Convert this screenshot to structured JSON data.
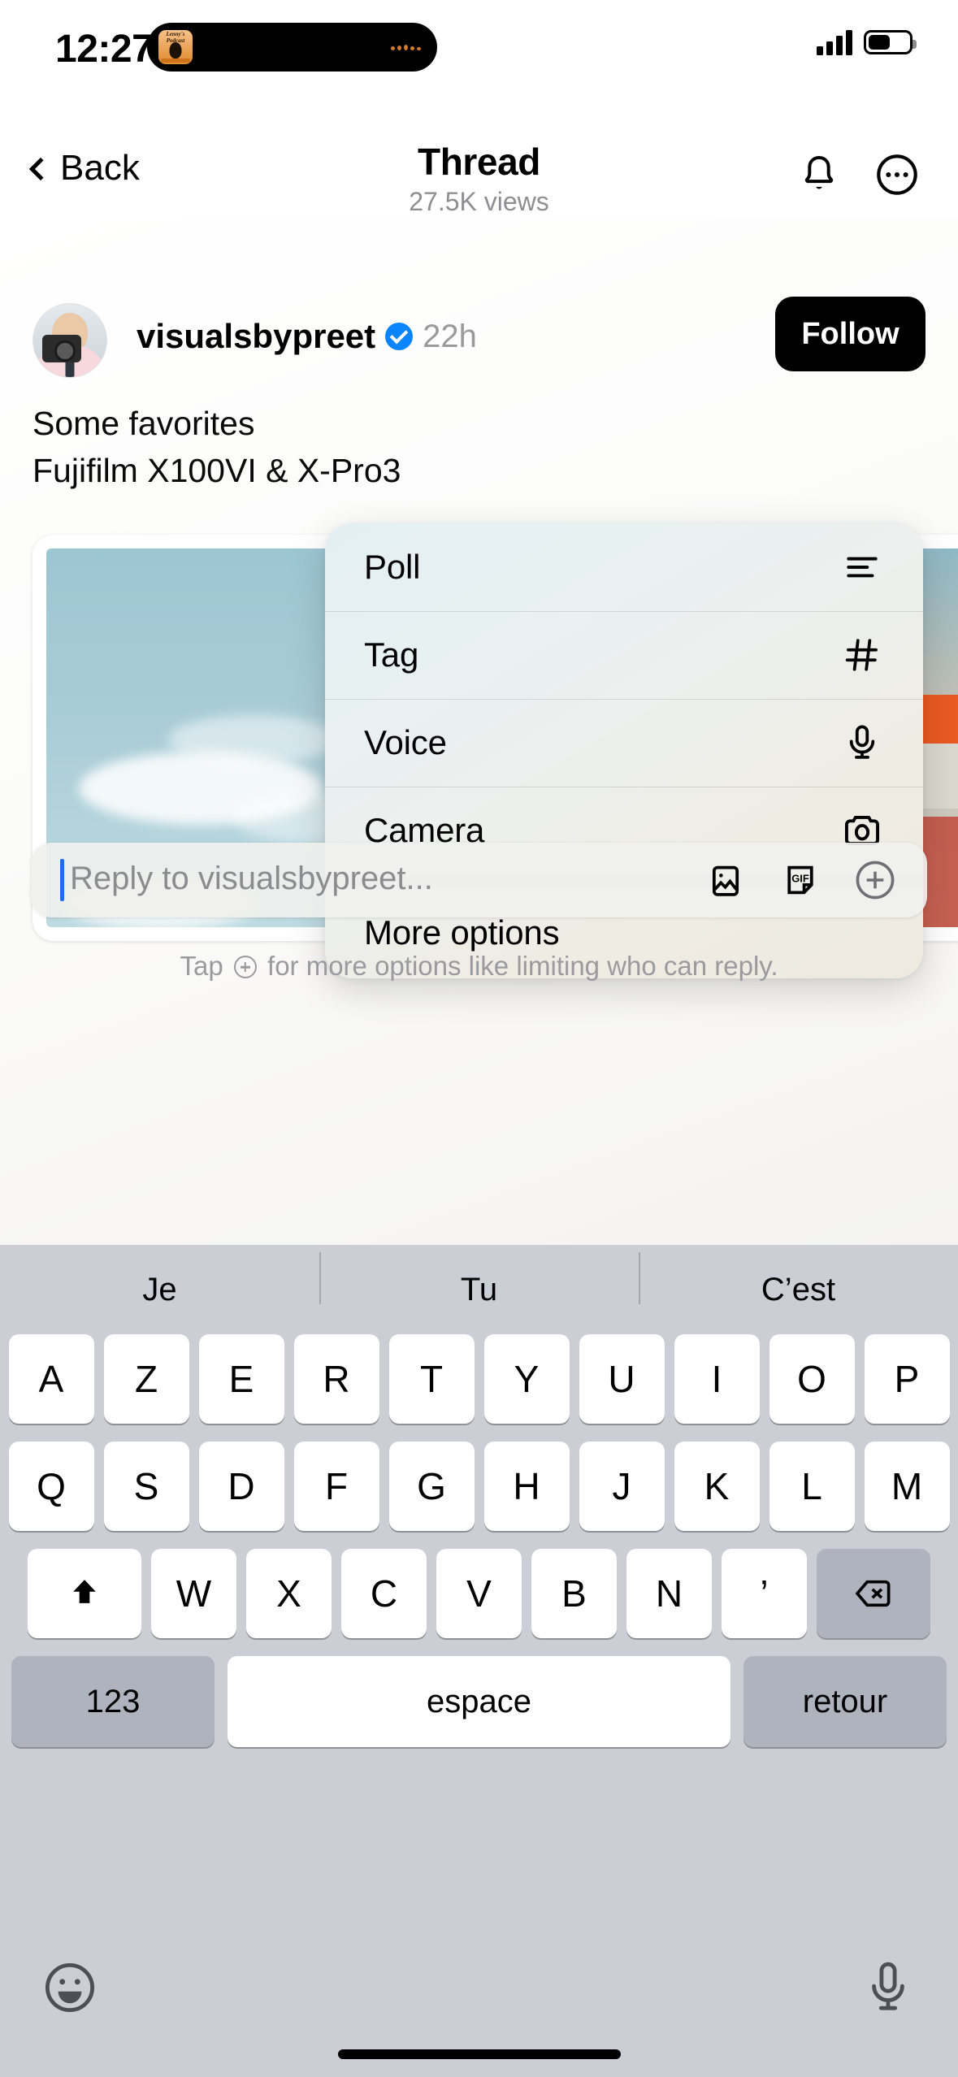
{
  "status_bar": {
    "time": "12:27",
    "dynamic_island": {
      "app": "Lenny's Podcast",
      "art_line1": "Lenny's",
      "art_line2": "Podcast"
    },
    "signal_icon": "cellular-signal-icon",
    "battery_icon": "battery-icon"
  },
  "navbar": {
    "back_label": "Back",
    "title": "Thread",
    "subtitle": "27.5K views",
    "bell_icon": "bell-icon",
    "more_icon": "more-circle-icon"
  },
  "post": {
    "username": "visualsbypreet",
    "verified": true,
    "timeago": "22h",
    "follow_label": "Follow",
    "text_line1": "Some favorites",
    "text_line2": "Fujifilm X100VI & X-Pro3",
    "media": [
      {
        "alt": "Shell gas station sign against blue sky with clouds"
      },
      {
        "alt": "Gas station canopy with orange trim"
      }
    ]
  },
  "context_menu": {
    "items": [
      {
        "label": "Poll",
        "icon": "poll-icon"
      },
      {
        "label": "Tag",
        "icon": "hashtag-icon"
      },
      {
        "label": "Voice",
        "icon": "microphone-icon"
      },
      {
        "label": "Camera",
        "icon": "camera-icon"
      },
      {
        "label": "More options",
        "icon": ""
      }
    ]
  },
  "reply_bar": {
    "placeholder": "Reply to visualsbypreet...",
    "value": "",
    "photo_icon": "photo-icon",
    "gif_icon": "gif-icon",
    "plus_icon": "plus-circle-icon"
  },
  "hint": {
    "before": "Tap",
    "after": "for more options like limiting who can reply."
  },
  "keyboard": {
    "language": "fr",
    "predictions": [
      "Je",
      "Tu",
      "C’est"
    ],
    "row1": [
      "A",
      "Z",
      "E",
      "R",
      "T",
      "Y",
      "U",
      "I",
      "O",
      "P"
    ],
    "row2": [
      "Q",
      "S",
      "D",
      "F",
      "G",
      "H",
      "J",
      "K",
      "L",
      "M"
    ],
    "row3": [
      "W",
      "X",
      "C",
      "V",
      "B",
      "N",
      "’"
    ],
    "shift_icon": "shift-icon",
    "backspace_icon": "backspace-icon",
    "numbers_label": "123",
    "space_label": "espace",
    "return_label": "retour",
    "emoji_icon": "emoji-icon",
    "dictation_icon": "microphone-icon"
  },
  "colors": {
    "accent_blue": "#0a84ff",
    "caret_blue": "#1d6ef5",
    "follow_bg": "#000000",
    "keyboard_bg": "#cbced4",
    "key_bg": "#ffffff",
    "key_gray": "#aeb3bd",
    "muted_text": "#8e8e93"
  }
}
